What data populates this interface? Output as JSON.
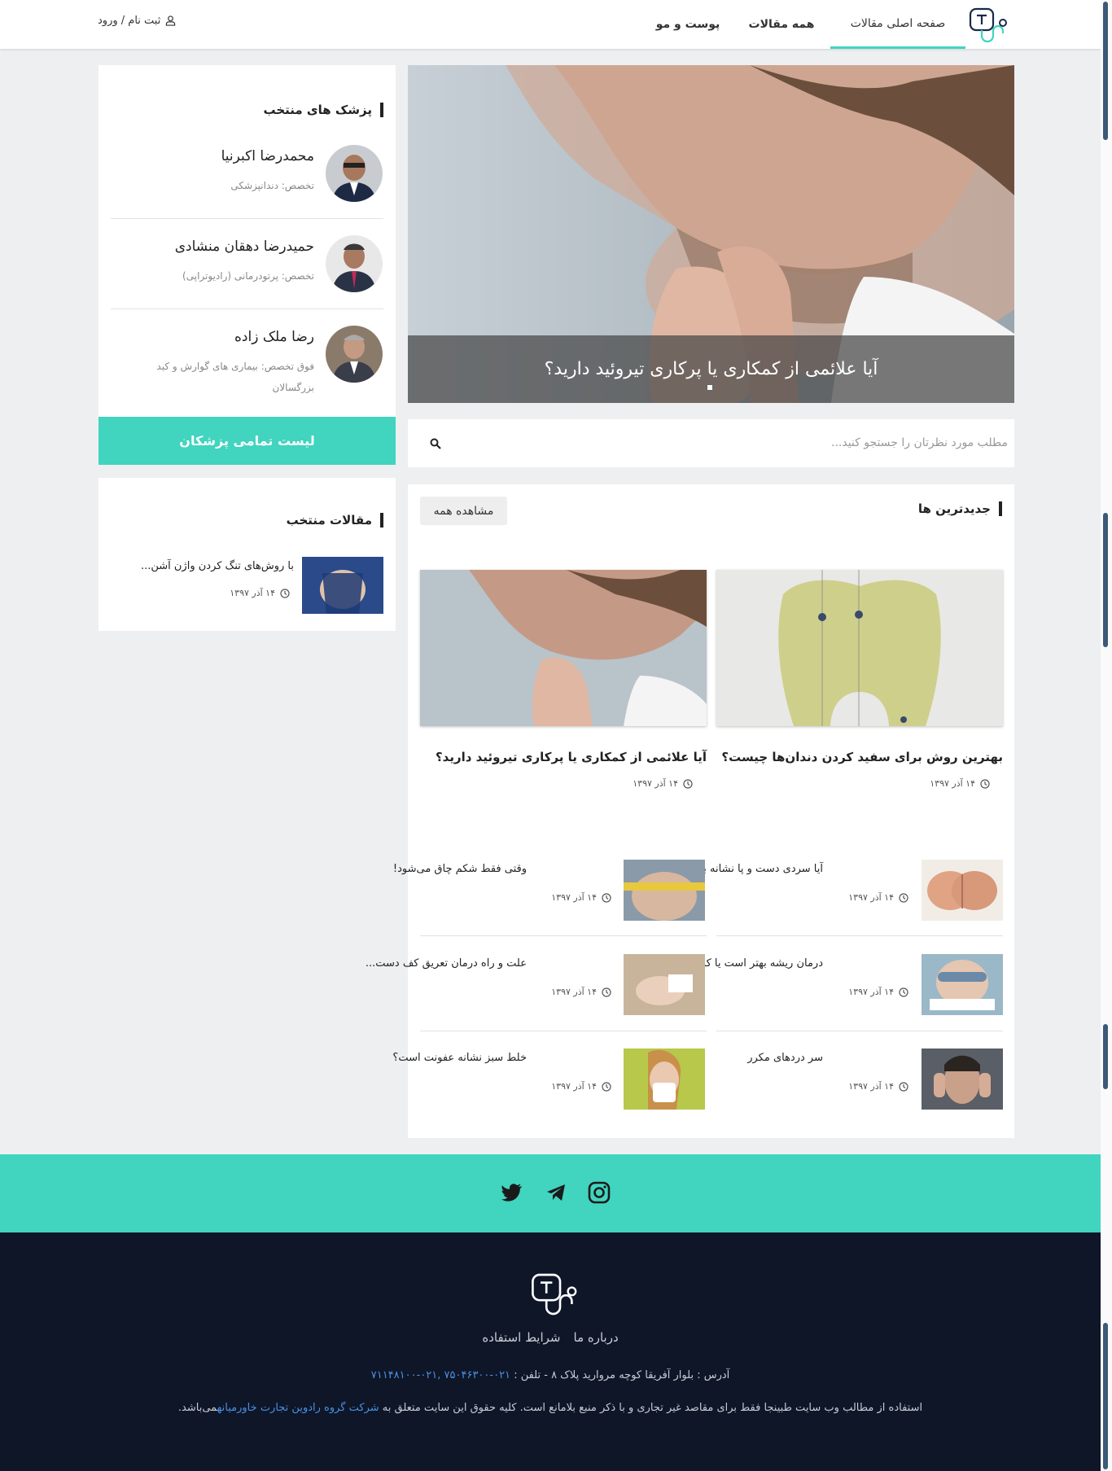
{
  "header": {
    "nav": {
      "home": "صفحه اصلی مقالات",
      "all_articles": "همه مقالات",
      "skin_hair": "پوست و مو"
    },
    "login_label": "ثبت نام / ورود",
    "login_icon": "user-icon"
  },
  "hero": {
    "caption": "آیا علائمی از کمکاری یا پرکاری تیروئید دارید؟"
  },
  "search": {
    "placeholder": "مطلب مورد نظرتان را جستجو کنید...",
    "icon": "search-icon"
  },
  "newest": {
    "title": "جدیدترین ها",
    "see_all": "مشاهده همه",
    "cards": [
      {
        "title": "بهترین روش برای سفید کردن دندان‌ها چیست؟",
        "date": "۱۴ آذر ۱۳۹۷"
      },
      {
        "title": "آیا علائمی از کمکاری یا پرکاری تیروئید دارید؟",
        "date": "۱۴ آذر ۱۳۹۷"
      }
    ],
    "list": [
      {
        "title": "آیا سردی دست و پا نشانه بیمار...",
        "date": "۱۴ آذر ۱۳۹۷"
      },
      {
        "title": "وقتی فقط شکم چاق می‌شود!",
        "date": "۱۴ آذر ۱۳۹۷"
      },
      {
        "title": "درمان ریشه بهتر است یا کشیدن ...",
        "date": "۱۴ آذر ۱۳۹۷"
      },
      {
        "title": "علت و راه درمان تعریق کف دست...",
        "date": "۱۴ آذر ۱۳۹۷"
      },
      {
        "title": "سر دردهای مکرر",
        "date": "۱۴ آذر ۱۳۹۷"
      },
      {
        "title": "خلط سبز نشانه عفونت است؟",
        "date": "۱۴ آذر ۱۳۹۷"
      }
    ]
  },
  "doctors": {
    "title": "پزشک های منتخب",
    "items": [
      {
        "name": "محمدرضا اکبرنیا",
        "specialty": "تخصص: دندانپزشکی"
      },
      {
        "name": "حمیدرضا دهقان منشادی",
        "specialty": "تخصص: پرتودرمانی (رادیوتراپی)"
      },
      {
        "name": "رضا ملک زاده",
        "specialty": "فوق تخصص: بیماری های گوارش و کبد بزرگسالان"
      }
    ],
    "button": "لیست تمامی پزشکان"
  },
  "featured": {
    "title": "مقالات منتخب",
    "items": [
      {
        "title": "با روش‌های تنگ کردن واژن آشن...",
        "date": "۱۴ آذر ۱۳۹۷"
      }
    ]
  },
  "footer": {
    "social_icons": [
      "instagram-icon",
      "telegram-icon",
      "twitter-icon"
    ],
    "links": {
      "about": "درباره ما",
      "terms": "شرایط استفاده"
    },
    "address": "آدرس : بلوار آفریقا کوچه مروارید پلاک ۸ - تلفن :",
    "phones": "۰۲۱-۷۵۰۴۶۳۰۰ ,۰۲۱-۷۱۱۴۸۱۰۰",
    "copyright_pre": "استفاده از مطالب وب سایت طبینجا فقط برای مقاصد غیر تجاری و با ذکر منبع بلامانع است. کلیه حقوق این سایت متعلق به",
    "copyright_link": "شرکت گروه رادوین تجارت خاورمیانه",
    "copyright_post": "می‌باشد."
  },
  "colors": {
    "accent": "#41d4bf",
    "footer_bg": "#0e1628",
    "page_bg": "#eeeff1",
    "link": "#4a90e2"
  }
}
